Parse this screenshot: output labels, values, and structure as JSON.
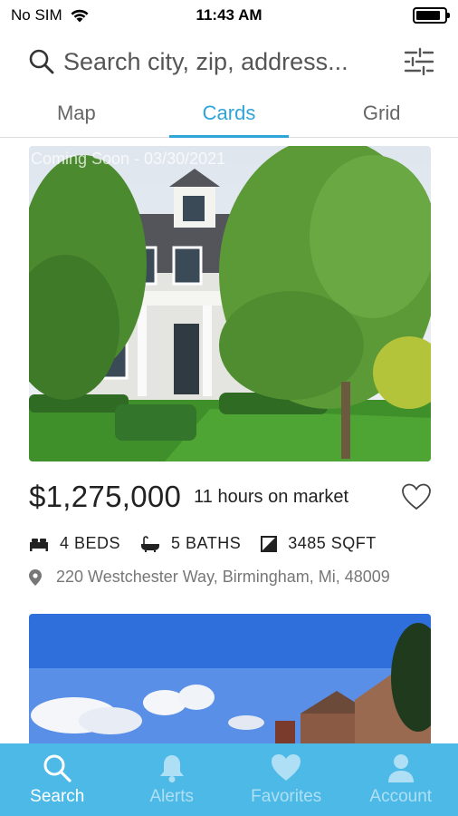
{
  "status": {
    "carrier": "No SIM",
    "time": "11:43 AM",
    "battery_level": 0.85
  },
  "search": {
    "placeholder": "Search city, zip, address..."
  },
  "tabs": [
    {
      "label": "Map",
      "active": false
    },
    {
      "label": "Cards",
      "active": true
    },
    {
      "label": "Grid",
      "active": false
    }
  ],
  "listings": [
    {
      "photo_caption": "Coming Soon - 03/30/2021",
      "price": "$1,275,000",
      "time_on_market": "11 hours on market",
      "beds": "4 BEDS",
      "baths": "5 BATHS",
      "sqft": "3485 SQFT",
      "address": "220 Westchester Way, Birmingham, Mi, 48009"
    }
  ],
  "bottom_nav": [
    {
      "label": "Search",
      "icon": "search-icon",
      "active": true
    },
    {
      "label": "Alerts",
      "icon": "bell-icon",
      "active": false
    },
    {
      "label": "Favorites",
      "icon": "heart-icon",
      "active": false
    },
    {
      "label": "Account",
      "icon": "person-icon",
      "active": false
    }
  ],
  "colors": {
    "accent": "#2fa4d8",
    "nav_bg": "#4db9e6"
  }
}
